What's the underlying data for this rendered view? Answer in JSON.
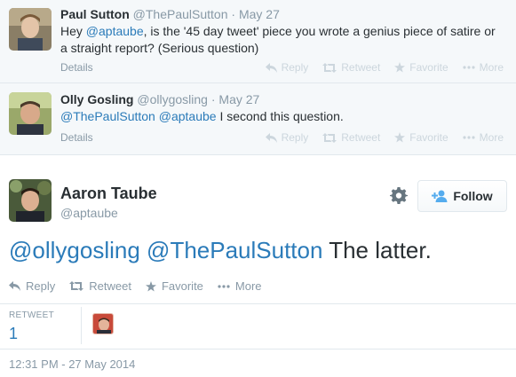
{
  "replies": [
    {
      "name": "Paul Sutton",
      "handle": "@ThePaulSutton",
      "date": "May 27",
      "text_parts": [
        "Hey ",
        "@aptaube",
        ", is the '45 day tweet' piece you wrote a genius piece of satire or a straight report? (Serious question)"
      ],
      "details": "Details"
    },
    {
      "name": "Olly Gosling",
      "handle": "@ollygosling",
      "date": "May 27",
      "text_parts": [
        "@ThePaulSutton",
        " ",
        "@aptaube",
        " I second this question."
      ],
      "details": "Details"
    }
  ],
  "reply_actions": {
    "reply": "Reply",
    "retweet": "Retweet",
    "favorite": "Favorite",
    "more": "More"
  },
  "separator": "·",
  "main_tweet": {
    "name": "Aaron Taube",
    "handle": "@aptaube",
    "follow_label": "Follow",
    "mention1": "@ollygosling",
    "mention2": "@ThePaulSutton",
    "text_rest": " The latter.",
    "actions": {
      "reply": "Reply",
      "retweet": "Retweet",
      "favorite": "Favorite",
      "more": "More"
    },
    "retweet_label": "RETWEET",
    "retweet_count": "1",
    "timestamp": "12:31 PM - 27 May 2014"
  },
  "colors": {
    "link": "#2b7bb9",
    "muted": "#8899a6",
    "reply_bg": "#f5f8fa",
    "faint_action": "#ccd6dd"
  },
  "icons": [
    "reply-icon",
    "retweet-icon",
    "favorite-icon",
    "more-icon",
    "gear-icon",
    "follow-icon"
  ]
}
